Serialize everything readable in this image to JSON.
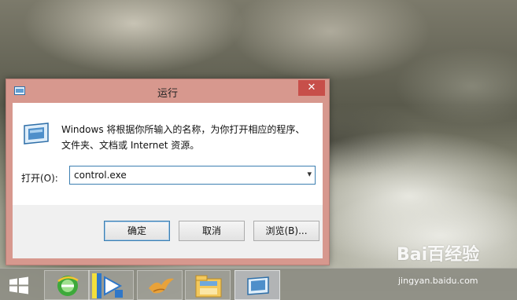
{
  "dialog": {
    "title": "运行",
    "close_glyph": "✕",
    "description": "Windows 将根据你所输入的名称，为你打开相应的程序、文件夹、文档或 Internet 资源。",
    "open_label": "打开(O):",
    "command_value": "control.exe",
    "ok_label": "确定",
    "cancel_label": "取消",
    "browse_label": "浏览(B)..."
  },
  "taskbar": {
    "items": [
      {
        "name": "start-button"
      },
      {
        "name": "ie-button"
      },
      {
        "name": "media-player-button"
      },
      {
        "name": "bird-app-button"
      },
      {
        "name": "file-explorer-button"
      },
      {
        "name": "run-dialog-task"
      }
    ]
  },
  "watermark": {
    "brand": "Bai百经验",
    "url": "jingyan.baidu.com"
  },
  "colors": {
    "titlebar": "#d7988e",
    "close": "#c74f4a",
    "focus_border": "#3c7fb1"
  }
}
